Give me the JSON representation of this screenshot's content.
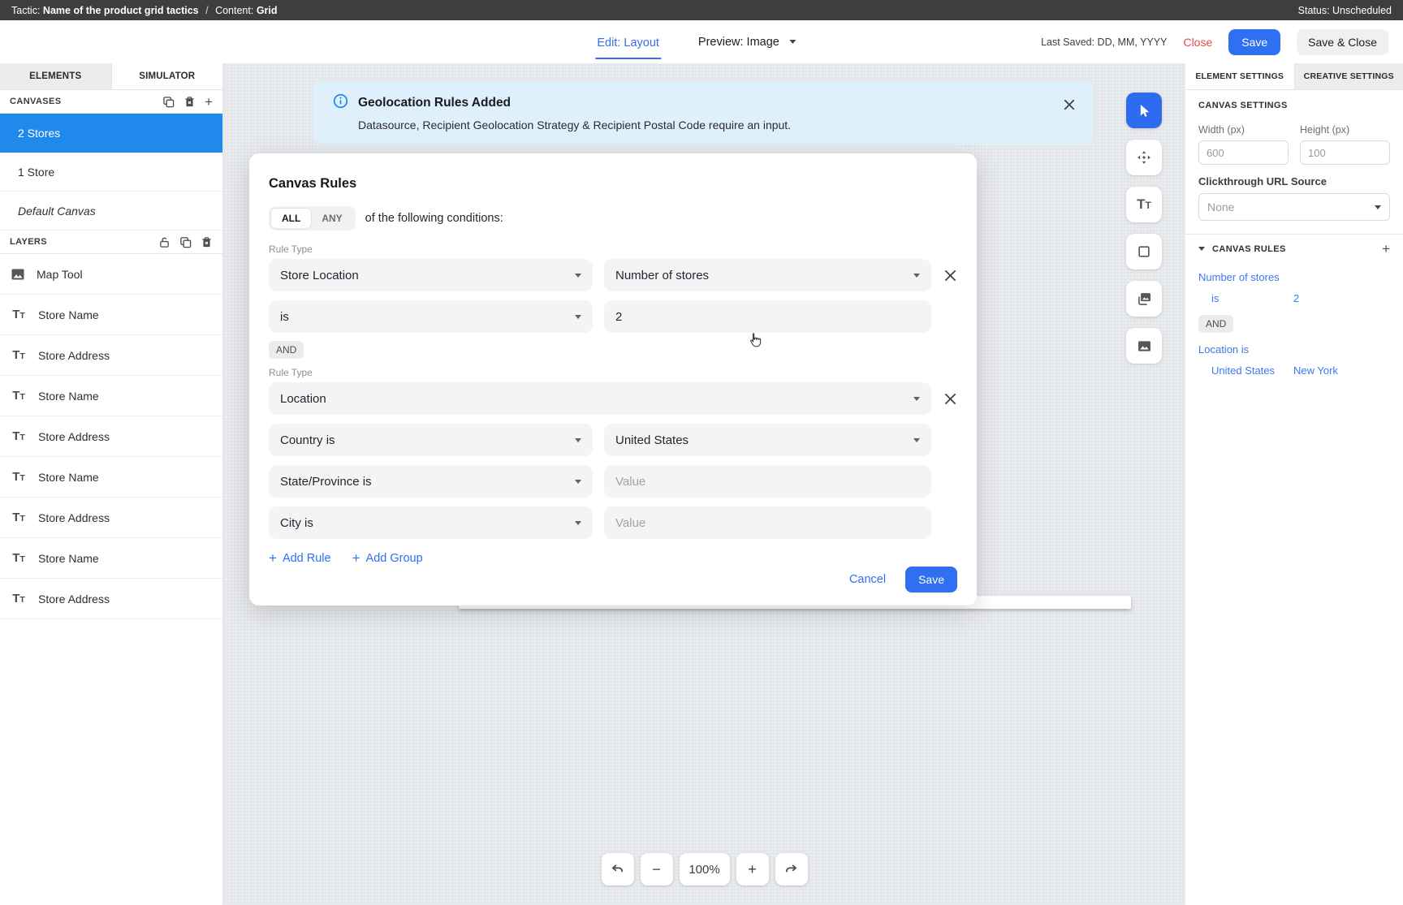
{
  "topbar": {
    "tactic_label": "Tactic:",
    "tactic_name": "Name of the product grid tactics",
    "separator": "/",
    "content_label": "Content:",
    "content_name": "Grid",
    "status": "Status: Unscheduled"
  },
  "header": {
    "edit_tab": "Edit: Layout",
    "preview_label": "Preview: Image",
    "last_saved": "Last Saved: DD, MM, YYYY",
    "close": "Close",
    "save": "Save",
    "save_and_close": "Save & Close"
  },
  "sidebar": {
    "tabs": {
      "elements": "ELEMENTS",
      "simulator": "SIMULATOR"
    },
    "canvases": {
      "title": "CANVASES",
      "items": [
        {
          "label": "2 Stores",
          "selected": true
        },
        {
          "label": "1 Store",
          "selected": false
        },
        {
          "label": "Default Canvas",
          "selected": false,
          "italic": true
        }
      ]
    },
    "layers": {
      "title": "LAYERS",
      "items": [
        {
          "icon": "image",
          "label": "Map Tool"
        },
        {
          "icon": "text",
          "label": "Store Name"
        },
        {
          "icon": "text",
          "label": "Store Address"
        },
        {
          "icon": "text",
          "label": "Store Name"
        },
        {
          "icon": "text",
          "label": "Store Address"
        },
        {
          "icon": "text",
          "label": "Store Name"
        },
        {
          "icon": "text",
          "label": "Store Address"
        },
        {
          "icon": "text",
          "label": "Store Name"
        },
        {
          "icon": "text",
          "label": "Store Address"
        }
      ]
    }
  },
  "banner": {
    "title": "Geolocation Rules Added",
    "message": "Datasource, Recipient Geolocation Strategy & Recipient Postal Code require an input."
  },
  "modal": {
    "title": "Canvas Rules",
    "match_all": "ALL",
    "match_any": "ANY",
    "conditions_text": "of the following conditions:",
    "rule_type_label": "Rule Type",
    "rule1": {
      "type": "Store Location",
      "field": "Number of stores",
      "operator": "is",
      "value": "2"
    },
    "conjunction": "AND",
    "rule2": {
      "type": "Location",
      "country_operator": "Country is",
      "country": "United States",
      "state_operator": "State/Province is",
      "city_operator": "City is"
    },
    "value_placeholder": "Value",
    "add_rule": "Add Rule",
    "add_group": "Add Group",
    "cancel": "Cancel",
    "save": "Save"
  },
  "toolbar": {
    "tools": [
      {
        "name": "select-tool",
        "selected": true
      },
      {
        "name": "move-tool",
        "selected": false
      },
      {
        "name": "text-tool",
        "selected": false
      },
      {
        "name": "rectangle-tool",
        "selected": false
      },
      {
        "name": "image-layers-tool",
        "selected": false
      },
      {
        "name": "image-tool",
        "selected": false
      }
    ]
  },
  "zoombar": {
    "zoom_out": "−",
    "zoom_level": "100%",
    "zoom_in": "+"
  },
  "settings": {
    "tabs": {
      "element": "ELEMENT SETTINGS",
      "creative": "CREATIVE SETTINGS"
    },
    "canvas_settings_title": "CANVAS SETTINGS",
    "width_label": "Width (px)",
    "width_value": "600",
    "height_label": "Height (px)",
    "height_value": "100",
    "clickthrough_label": "Clickthrough URL Source",
    "clickthrough_value": "None",
    "canvas_rules": {
      "title": "CANVAS RULES",
      "rule1_field": "Number of stores",
      "rule1_operator": "is",
      "rule1_value": "2",
      "conjunction": "AND",
      "rule2_field": "Location is",
      "rule2_country": "United States",
      "rule2_state": "New York"
    }
  },
  "colors": {
    "topbar_bg": "#3e3e3e",
    "accent_blue": "#2f6ff2",
    "selected_item_blue": "#2089ec",
    "banner_blue_bg": "#def0fc",
    "info_blue": "#2089ec",
    "close_red": "#e5484d",
    "rules_link_blue": "#3c78f0",
    "canvas_bg": "#e8eaed"
  }
}
